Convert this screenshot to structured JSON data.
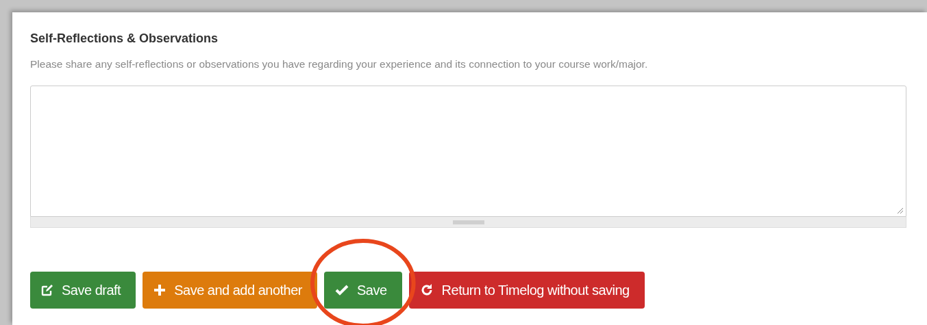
{
  "section": {
    "title": "Self-Reflections & Observations",
    "description": "Please share any self-reflections or observations you have regarding your experience and its connection to your course work/major."
  },
  "buttons": [
    {
      "label": "Save draft",
      "kind": "edit",
      "color": "#3a8a3c",
      "highlighted": false
    },
    {
      "label": "Save and add another",
      "kind": "plus",
      "color": "#dd7b0c",
      "highlighted": false
    },
    {
      "label": "Save",
      "kind": "check",
      "color": "#3a8a3c",
      "highlighted": true
    },
    {
      "label": "Return to Timelog without saving",
      "kind": "refresh",
      "color": "#cd2b2b",
      "highlighted": false
    }
  ]
}
